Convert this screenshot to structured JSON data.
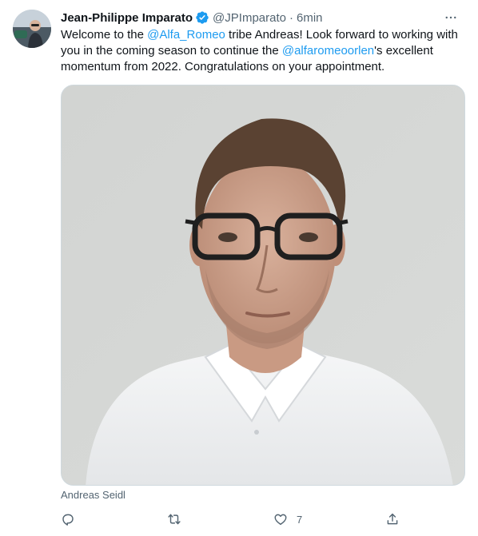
{
  "tweet": {
    "author_name": "Jean-Philippe Imparato",
    "handle": "@JPImparato",
    "separator": "·",
    "time": "6min",
    "text_parts": {
      "p1": "Welcome to the ",
      "m1": "@Alfa_Romeo",
      "p2": " tribe Andreas! Look forward to working with you in the coming season to continue the ",
      "m2": "@alfaromeoorlen",
      "p3": "'s excellent momentum from 2022. Congratulations on your appointment."
    },
    "media_caption": "Andreas Seidl"
  },
  "actions": {
    "reply_count": "",
    "retweet_count": "",
    "like_count": "7"
  },
  "icons": {
    "verified": "verified-badge-icon",
    "more": "more-icon",
    "reply": "reply-icon",
    "retweet": "retweet-icon",
    "like": "heart-icon",
    "share": "share-icon"
  },
  "colors": {
    "accent": "#1d9bf0",
    "text": "#0f1419",
    "secondary": "#536471"
  }
}
